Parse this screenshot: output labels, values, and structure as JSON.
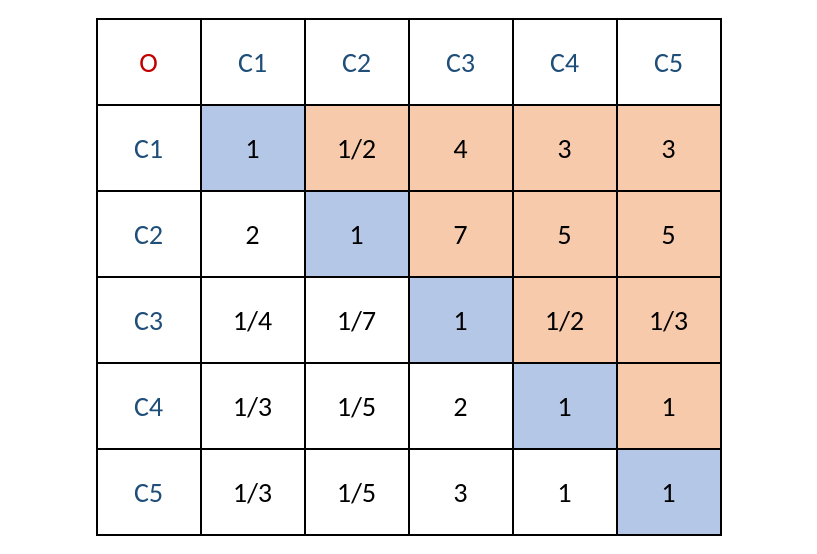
{
  "corner": "O",
  "col_headers": [
    "C1",
    "C2",
    "C3",
    "C4",
    "C5"
  ],
  "row_headers": [
    "C1",
    "C2",
    "C3",
    "C4",
    "C5"
  ],
  "matrix": [
    [
      "1",
      "1/2",
      "4",
      "3",
      "3"
    ],
    [
      "2",
      "1",
      "7",
      "5",
      "5"
    ],
    [
      "1/4",
      "1/7",
      "1",
      "1/2",
      "1/3"
    ],
    [
      "1/3",
      "1/5",
      "2",
      "1",
      "1"
    ],
    [
      "1/3",
      "1/5",
      "3",
      "1",
      "1"
    ]
  ],
  "chart_data": {
    "type": "table",
    "title": "",
    "row_labels": [
      "C1",
      "C2",
      "C3",
      "C4",
      "C5"
    ],
    "col_labels": [
      "C1",
      "C2",
      "C3",
      "C4",
      "C5"
    ],
    "values": [
      [
        1,
        0.5,
        4,
        3,
        3
      ],
      [
        2,
        1,
        7,
        5,
        5
      ],
      [
        0.25,
        0.142857,
        1,
        0.5,
        0.333333
      ],
      [
        0.333333,
        0.2,
        2,
        1,
        1
      ],
      [
        0.333333,
        0.2,
        3,
        1,
        1
      ]
    ],
    "display": [
      [
        "1",
        "1/2",
        "4",
        "3",
        "3"
      ],
      [
        "2",
        "1",
        "7",
        "5",
        "5"
      ],
      [
        "1/4",
        "1/7",
        "1",
        "1/2",
        "1/3"
      ],
      [
        "1/3",
        "1/5",
        "2",
        "1",
        "1"
      ],
      [
        "1/3",
        "1/5",
        "3",
        "1",
        "1"
      ]
    ],
    "highlight": {
      "diagonal_color": "#b4c7e7",
      "upper_triangle_color": "#f7caac"
    }
  }
}
